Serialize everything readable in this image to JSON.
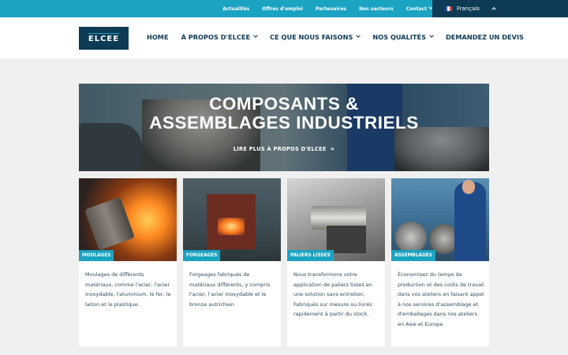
{
  "topbar": {
    "links": [
      "Actualités",
      "Offres d'emploi",
      "Partenaires",
      "Nos secteurs",
      "Contact"
    ],
    "language": "Français",
    "colors": {
      "topbar": "#1ba3c2",
      "language_bg": "#0d3b55"
    }
  },
  "header": {
    "logo_text": "ELCEE",
    "nav": [
      {
        "label": "HOME",
        "dropdown": false
      },
      {
        "label": "À PROPOS D'ELCEE",
        "dropdown": true
      },
      {
        "label": "CE QUE NOUS FAISONS",
        "dropdown": true
      },
      {
        "label": "NOS QUALITÉS",
        "dropdown": true
      },
      {
        "label": "DEMANDEZ UN DEVIS",
        "dropdown": false
      }
    ]
  },
  "hero": {
    "title_line1": "COMPOSANTS &",
    "title_line2": "ASSEMBLAGES INDUSTRIELS",
    "link": "LIRE PLUS À PROPOS D'ELCEE"
  },
  "cards": [
    {
      "tag": "MOULAGES",
      "text": "Moulages de différents matériaux, comme l'acier, l'acier inoxydable, l'aluminium, le fer, le laiton et le plastique."
    },
    {
      "tag": "FORGEAGES",
      "text": "Forgeages fabriqués de matériaux différents, y compris l'acier, l'acier inoxydable et le bronze autrichien"
    },
    {
      "tag": "PALIERS LISSES",
      "text": "Nous transformons votre application de paliers lisses en une solution sans entretien. Fabriqués sur mesure ou livrés rapidement à partir du stock."
    },
    {
      "tag": "ASSEMBLAGES",
      "text": "Économisez du temps de production et des coûts de travail dans vos ateliers en faisant appel à nos services d'assemblage et d'emballages dans nos ateliers en Asie et Europe."
    }
  ],
  "theme": {
    "accent": "#1ba3c2",
    "navy": "#0d3b55",
    "background": "#f0f0f0"
  }
}
